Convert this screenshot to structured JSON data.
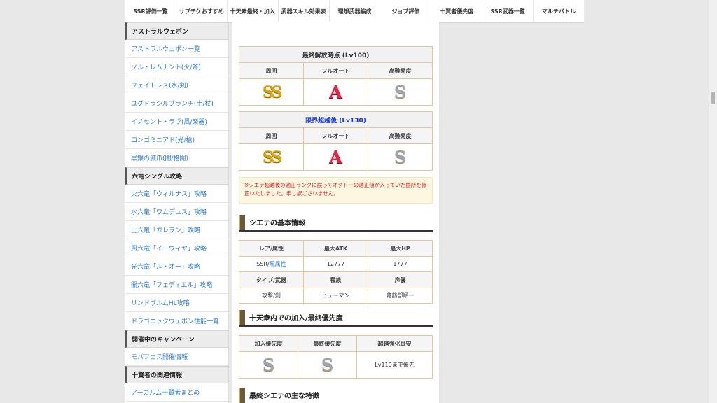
{
  "nav": [
    "SSR評価一覧",
    "サプチケおすすめ",
    "十天衆最終・加入",
    "武器スキル効果表",
    "理想武器編成",
    "ジョブ評価",
    "十賢者優先度",
    "SSR武器一覧",
    "マルチバトル"
  ],
  "sidebar": {
    "sections": [
      {
        "heading": "アストラルウェポン",
        "links": [
          "アストラルウェポン一覧",
          "ソル・レムナント(火/斧)",
          "フェイトレス(水/剣)",
          "ユグドラシルブランチ(土/杖)",
          "イノセント・ラヴ(風/楽器)",
          "ロンゴミニアド(光/槍)",
          "黒銀の滅爪(闇/格闘)"
        ]
      },
      {
        "heading": "六竜シングル攻略",
        "links": [
          "火六竜「ウィルナス」攻略",
          "水六竜「ワムデュス」攻略",
          "土六竜「ガレヲン」攻略",
          "風六竜「イーウィヤ」攻略",
          "光六竜「ル・オー」攻略",
          "闇六竜「フェディエル」攻略",
          "リンドヴルムHL攻略",
          "ドラゴニックウェポン性能一覧"
        ]
      },
      {
        "heading": "開催中のキャンペーン",
        "links": [
          "モバフェス開催情報"
        ]
      },
      {
        "heading": "十賢者の関連情報",
        "links": [
          "アーカルム十賢者まとめ"
        ]
      }
    ]
  },
  "final_release": {
    "title": "最終解放時点 (Lv100)",
    "headers": [
      "周回",
      "フルオート",
      "高難易度"
    ],
    "ranks": [
      "SS",
      "A",
      "S"
    ]
  },
  "limit_break": {
    "title": "限界超越後 (Lv130)",
    "headers": [
      "周回",
      "フルオート",
      "高難易度"
    ],
    "ranks": [
      "SS",
      "A",
      "S"
    ]
  },
  "notice": "※シエテ超越後の適正ランクに誤ってオクトーの適正値が入っていた箇所を修正いたしました。申し訳ございません。",
  "basic_info": {
    "heading": "シエテの基本情報",
    "headers1": [
      "レア/属性",
      "最大ATK",
      "最大HP"
    ],
    "rarity": "SSR/",
    "element": "風属性",
    "atk": "12777",
    "hp": "1777",
    "headers2": [
      "タイプ/武器",
      "種族",
      "声優"
    ],
    "type": "攻撃/剣",
    "race": "ヒューマン",
    "voice": "諏訪部順一"
  },
  "priority": {
    "heading": "十天衆内での加入/最終優先度",
    "headers": [
      "加入優先度",
      "最終優先度",
      "超越強化目安"
    ],
    "join": "S",
    "final": "S",
    "target": "Lv110まで優先"
  },
  "features_heading": "最終シエテの主な特徴"
}
